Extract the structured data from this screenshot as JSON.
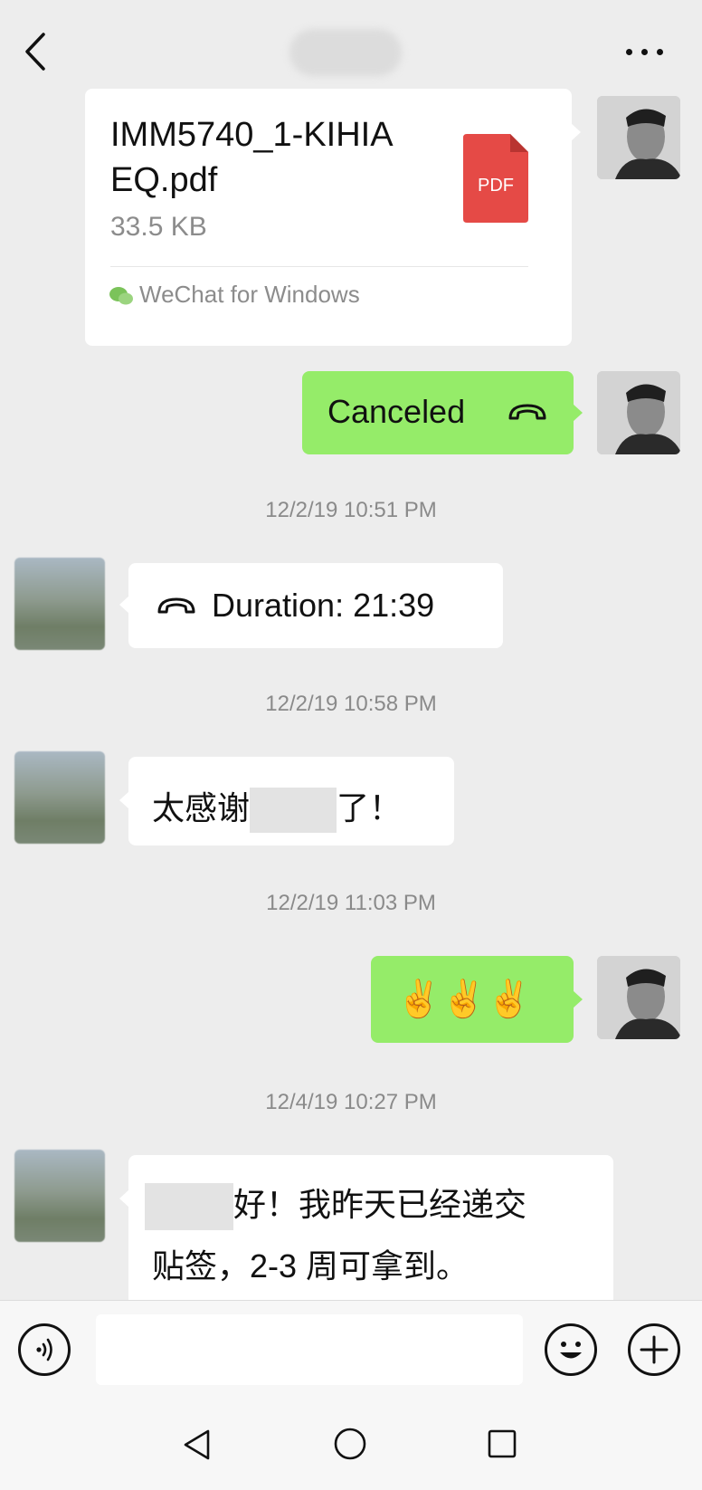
{
  "messages": {
    "file": {
      "name": "IMM5740_1-KIHIAEQ.pdf",
      "size": "33.5 KB",
      "source": "WeChat for Windows",
      "badge": "PDF"
    },
    "call_canceled": "Canceled",
    "ts1": "12/2/19 10:51 PM",
    "call_duration": "Duration: 21:39",
    "ts2": "12/2/19 10:58 PM",
    "thanks_prefix": "太感谢",
    "thanks_suffix": "了！",
    "ts3": "12/2/19 11:03 PM",
    "emoji": "✌️✌️✌️",
    "ts4": "12/4/19 10:27 PM",
    "reply_line1": "好！我昨天已经递交",
    "reply_line2": "贴签，2-3 周可拿到。"
  },
  "input": {
    "placeholder": ""
  },
  "colors": {
    "background": "#ededed",
    "green_bubble": "#95ec69",
    "pdf_red": "#e54a46"
  }
}
